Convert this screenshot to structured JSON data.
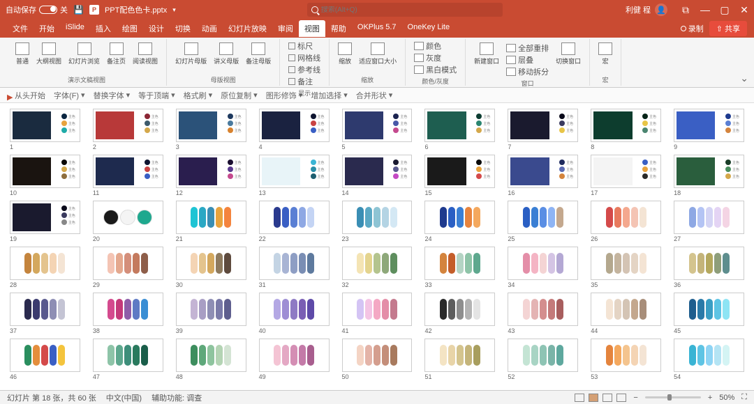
{
  "titlebar": {
    "autosave": "自动保存",
    "autosave_state": "关",
    "filename": "PPT配色色卡.pptx",
    "search_placeholder": "搜索(Alt+Q)",
    "username": "利健 程"
  },
  "menubar": {
    "tabs": [
      "文件",
      "开始",
      "iSlide",
      "插入",
      "绘图",
      "设计",
      "切换",
      "动画",
      "幻灯片放映",
      "审阅",
      "视图",
      "帮助",
      "OKPlus 5.7",
      "OneKey Lite"
    ],
    "active": 10,
    "record": "录制",
    "share": "共享"
  },
  "ribbon": {
    "g1": {
      "label": "演示文稿视图",
      "items": [
        "普通",
        "大纲视图",
        "幻灯片浏览",
        "备注页",
        "阅读视图"
      ]
    },
    "g2": {
      "label": "母版视图",
      "items": [
        "幻灯片母版",
        "讲义母版",
        "备注母版"
      ]
    },
    "g3": {
      "label": "显示",
      "items": [
        "标尺",
        "网格线",
        "参考线",
        "备注"
      ]
    },
    "g4": {
      "label": "缩放",
      "items": [
        "缩放",
        "适应窗口大小"
      ]
    },
    "g5": {
      "label": "颜色/灰度",
      "items": [
        "颜色",
        "灰度",
        "黑白模式"
      ]
    },
    "g6": {
      "label": "窗口",
      "items": [
        "新建窗口",
        "全部重排",
        "层叠",
        "移动拆分",
        "切换窗口"
      ]
    },
    "g7": {
      "label": "宏",
      "items": [
        "宏"
      ]
    }
  },
  "secondbar": [
    "从头开始",
    "字体(F)",
    "替换字体",
    "等于顶端",
    "格式刷",
    "原位复制",
    "图形修饰",
    "增加选择",
    "合并形状"
  ],
  "slides": {
    "rows": [
      {
        "n": 1,
        "type": "img",
        "bg": "#1a2b3f",
        "d": [
          "#0a2540",
          "#e8a33d",
          "#1faba8"
        ]
      },
      {
        "n": 2,
        "type": "img",
        "bg": "#b83939",
        "d": [
          "#8b2635",
          "#3d5a6c",
          "#d4a84b"
        ]
      },
      {
        "n": 3,
        "type": "img",
        "bg": "#2b5279",
        "d": [
          "#1e3a5f",
          "#4a7a9e",
          "#d8822e"
        ]
      },
      {
        "n": 4,
        "type": "img",
        "bg": "#1a2240",
        "d": [
          "#0e1530",
          "#c94343",
          "#3a5fc4"
        ]
      },
      {
        "n": 5,
        "type": "img",
        "bg": "#2e3a6e",
        "d": [
          "#1c2450",
          "#4858a8",
          "#c44a8e"
        ]
      },
      {
        "n": 6,
        "type": "img",
        "bg": "#1e5e50",
        "d": [
          "#0d3d32",
          "#2a8570",
          "#d4a84b"
        ]
      },
      {
        "n": 7,
        "type": "img",
        "bg": "#1a1a2e",
        "d": [
          "#0a0a1a",
          "#3a3a5e",
          "#e8c547"
        ]
      },
      {
        "n": 8,
        "type": "img",
        "bg": "#0d3d2e",
        "d": [
          "#062418",
          "#e8c547",
          "#4a8570"
        ]
      },
      {
        "n": 9,
        "type": "img",
        "bg": "#3a5fc4",
        "d": [
          "#1e3a8e",
          "#5a7fd4",
          "#d4843d"
        ]
      },
      {
        "n": 10,
        "type": "img",
        "bg": "#1a1410",
        "d": [
          "#0a0806",
          "#d4a84b",
          "#8e6e3d"
        ]
      },
      {
        "n": 11,
        "type": "img",
        "bg": "#1e2a4e",
        "d": [
          "#0e1530",
          "#c94343",
          "#3a5fc4"
        ]
      },
      {
        "n": 12,
        "type": "img",
        "bg": "#2a1e4e",
        "d": [
          "#1a0e30",
          "#5a3a8e",
          "#c44a8e"
        ]
      },
      {
        "n": 13,
        "type": "img",
        "bg": "#e8f4f8",
        "d": [
          "#3ab4d4",
          "#2a8ea8",
          "#1e5e70"
        ]
      },
      {
        "n": 14,
        "type": "img",
        "bg": "#2a2a4e",
        "d": [
          "#1a1a30",
          "#5a5a8e",
          "#c44ac4"
        ]
      },
      {
        "n": 15,
        "type": "img",
        "bg": "#1a1a1a",
        "d": [
          "#0a0a0a",
          "#e8a33d",
          "#d44a4a"
        ]
      },
      {
        "n": 16,
        "type": "img",
        "bg": "#3a4a8e",
        "d": [
          "#1e2a5e",
          "#5a6ab4",
          "#d4843d"
        ]
      },
      {
        "n": 17,
        "type": "img",
        "bg": "#f4f4f4",
        "d": [
          "#3a5fc4",
          "#e8a33d",
          "#2a2a2a"
        ]
      },
      {
        "n": 18,
        "type": "img",
        "bg": "#2a5e3d",
        "d": [
          "#1a3d28",
          "#4a8e5e",
          "#d4a84b"
        ]
      },
      {
        "n": 19,
        "type": "img",
        "bg": "#1a1a2e",
        "d": [
          "#0a0a1a",
          "#3a3a5e",
          "#888"
        ]
      },
      {
        "n": 20,
        "type": "circles",
        "c": [
          "#1a1a1a",
          "#f4f4f4",
          "#1ea88e"
        ]
      },
      {
        "n": 21,
        "type": "pal",
        "c": [
          "#1ec4d4",
          "#2aa8c4",
          "#3a8eb4",
          "#e8a33d",
          "#f4843d"
        ]
      },
      {
        "n": 22,
        "type": "pal",
        "c": [
          "#2a3a8e",
          "#3a5fc4",
          "#5a7fd4",
          "#8ea8e4",
          "#c4d4f4"
        ]
      },
      {
        "n": 23,
        "type": "pal",
        "c": [
          "#3a8eb4",
          "#5aa8c4",
          "#8ec4d4",
          "#b4d4e4",
          "#d4e8f4"
        ]
      },
      {
        "n": 24,
        "type": "pal",
        "c": [
          "#1e3a8e",
          "#2a5fc4",
          "#3a7fd4",
          "#e8843d",
          "#f4a85e"
        ]
      },
      {
        "n": 25,
        "type": "pal",
        "c": [
          "#2a5fc4",
          "#3a7fd4",
          "#5a8ee4",
          "#8eb4f4",
          "#c4a88e"
        ]
      },
      {
        "n": 26,
        "type": "pal",
        "c": [
          "#d44a4a",
          "#e87a5e",
          "#f4a88e",
          "#f4c4b4",
          "#f4e4d4"
        ]
      },
      {
        "n": 27,
        "type": "pal",
        "c": [
          "#8ea8e4",
          "#b4c4f4",
          "#d4d4f4",
          "#e4d4f4",
          "#f4d4e4"
        ]
      },
      {
        "n": 28,
        "type": "pal",
        "c": [
          "#c4843d",
          "#d4a85e",
          "#e4c48e",
          "#f4d4b4",
          "#f4e4d4"
        ]
      },
      {
        "n": 29,
        "type": "pal",
        "c": [
          "#f4c4b4",
          "#e4a88e",
          "#d48e7a",
          "#c47a5e",
          "#8e5e4a"
        ]
      },
      {
        "n": 30,
        "type": "pal",
        "c": [
          "#f4d4b4",
          "#e4c48e",
          "#d4a85e",
          "#8e7a5e",
          "#5e4a3d"
        ]
      },
      {
        "n": 31,
        "type": "pal",
        "c": [
          "#c4d4e4",
          "#a8b4d4",
          "#8e9ec4",
          "#7a8eb4",
          "#5e7a9e"
        ]
      },
      {
        "n": 32,
        "type": "pal",
        "c": [
          "#f4e4b4",
          "#e4d48e",
          "#b4c48e",
          "#8ea87a",
          "#5e8e5e"
        ]
      },
      {
        "n": 33,
        "type": "pal",
        "c": [
          "#d4843d",
          "#c45e2a",
          "#b4d4c4",
          "#8ec4a8",
          "#5ea88e"
        ]
      },
      {
        "n": 34,
        "type": "pal",
        "c": [
          "#e48ea8",
          "#f4b4c4",
          "#f4d4d4",
          "#d4c4e4",
          "#b4a8d4"
        ]
      },
      {
        "n": 35,
        "type": "pal",
        "c": [
          "#b4a88e",
          "#c4b49e",
          "#d4c4b4",
          "#e4d4c4",
          "#f4e4d4"
        ]
      },
      {
        "n": 36,
        "type": "pal",
        "c": [
          "#d4c48e",
          "#c4b47a",
          "#b4a85e",
          "#8e9e7a",
          "#5e8e8e"
        ]
      },
      {
        "n": 37,
        "type": "pal",
        "c": [
          "#2a2a4e",
          "#3a3a6e",
          "#5a5a8e",
          "#8e8eb4",
          "#c4c4d4"
        ]
      },
      {
        "n": 38,
        "type": "pal",
        "c": [
          "#d44a8e",
          "#c43a7a",
          "#8e5ea8",
          "#5e7ac4",
          "#3a8ed4"
        ]
      },
      {
        "n": 39,
        "type": "pal",
        "c": [
          "#c4b4d4",
          "#a89ec4",
          "#8e8eb4",
          "#7a7aa8",
          "#5e5e8e"
        ]
      },
      {
        "n": 40,
        "type": "pal",
        "c": [
          "#b4a8e4",
          "#9e8ed4",
          "#8e7ac4",
          "#7a5eb4",
          "#5e4aa8"
        ]
      },
      {
        "n": 41,
        "type": "pal",
        "c": [
          "#d4c4f4",
          "#f4c4e4",
          "#f4a8c4",
          "#e48ea8",
          "#c47a8e"
        ]
      },
      {
        "n": 42,
        "type": "pal",
        "c": [
          "#2a2a2a",
          "#5e5e5e",
          "#8e8e8e",
          "#b4b4b4",
          "#e4e4e4"
        ]
      },
      {
        "n": 43,
        "type": "pal",
        "c": [
          "#f4d4d4",
          "#e4b4b4",
          "#d48e8e",
          "#c47a7a",
          "#a85e5e"
        ]
      },
      {
        "n": 44,
        "type": "pal",
        "c": [
          "#f4e4d4",
          "#e4d4c4",
          "#d4c4b4",
          "#c4a88e",
          "#a88e7a"
        ]
      },
      {
        "n": 45,
        "type": "pal",
        "c": [
          "#1e5e8e",
          "#2a7aa8",
          "#3a9ec4",
          "#5ec4e4",
          "#8ee4f4"
        ]
      },
      {
        "n": 46,
        "type": "pal",
        "c": [
          "#2a8e5e",
          "#e48e3d",
          "#d44a4a",
          "#3a5fc4",
          "#f4c43d"
        ]
      },
      {
        "n": 47,
        "type": "pal",
        "c": [
          "#8ec4a8",
          "#5ea88e",
          "#3d8e7a",
          "#2a7a5e",
          "#1a5e4a"
        ]
      },
      {
        "n": 48,
        "type": "pal",
        "c": [
          "#3d8e5e",
          "#5ea87a",
          "#8ec49e",
          "#b4d4b4",
          "#d4e4d4"
        ]
      },
      {
        "n": 49,
        "type": "pal",
        "c": [
          "#f4c4d4",
          "#e4a8c4",
          "#d48eb4",
          "#c47aa8",
          "#a85e8e"
        ]
      },
      {
        "n": 50,
        "type": "pal",
        "c": [
          "#f4d4c4",
          "#e4b4a8",
          "#d49e8e",
          "#c48e7a",
          "#a87a5e"
        ]
      },
      {
        "n": 51,
        "type": "pal",
        "c": [
          "#f4e4c4",
          "#e8d4a8",
          "#d4c48e",
          "#c4b47a",
          "#a89e5e"
        ]
      },
      {
        "n": 52,
        "type": "pal",
        "c": [
          "#c4e4d4",
          "#a8d4c4",
          "#8ec4b4",
          "#7ab4a8",
          "#5ea89e"
        ]
      },
      {
        "n": 53,
        "type": "pal",
        "c": [
          "#e4843d",
          "#f4a85e",
          "#f4c48e",
          "#f4d4b4",
          "#f4e4d4"
        ]
      },
      {
        "n": 54,
        "type": "pal",
        "c": [
          "#3ab4d4",
          "#5ec4e4",
          "#8ed4f4",
          "#b4e4f4",
          "#d4f4f4"
        ]
      }
    ]
  },
  "statusbar": {
    "slide_info": "幻灯片 第 18 张，共 60 张",
    "lang": "中文(中国)",
    "access": "辅助功能: 调查",
    "zoom": "50%"
  }
}
